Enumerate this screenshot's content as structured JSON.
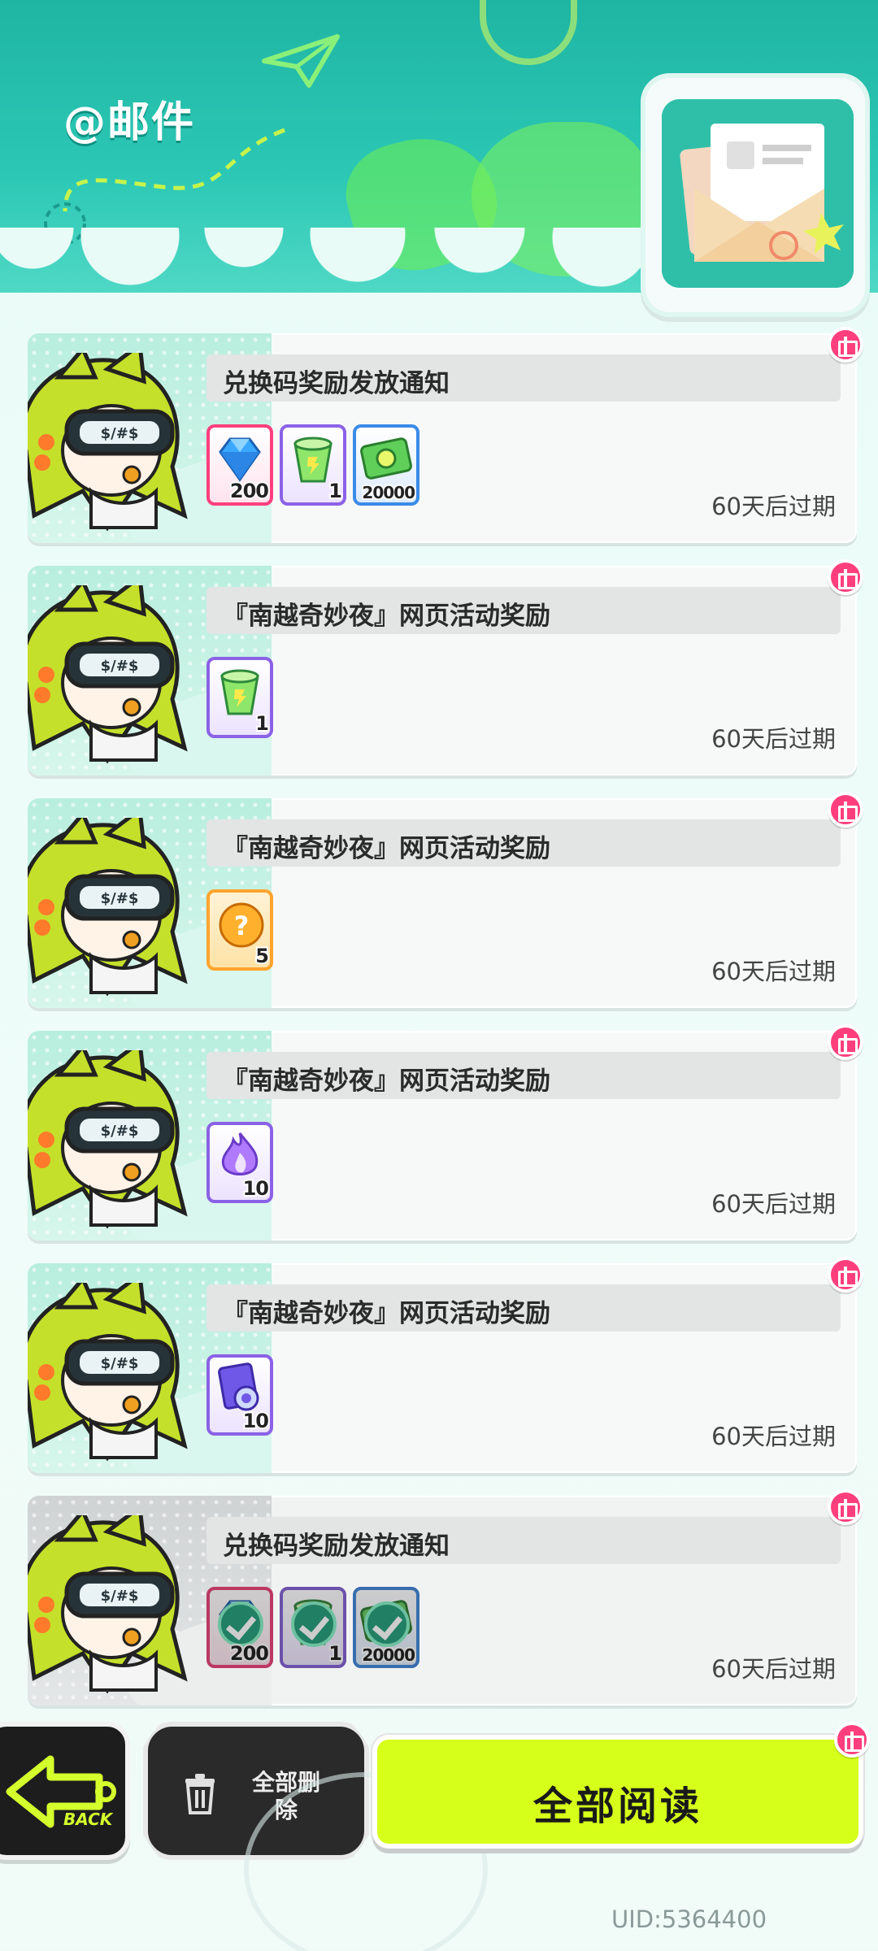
{
  "header": {
    "title": "@邮件"
  },
  "mails": [
    {
      "title": "兑换码奖励发放通知",
      "expire": "60天后过期",
      "read": false,
      "rewards": [
        {
          "icon": "diamond-icon",
          "qty": "200",
          "rarity": "pink"
        },
        {
          "icon": "green-drink-icon",
          "qty": "1",
          "rarity": "purple"
        },
        {
          "icon": "cash-icon",
          "qty": "20000",
          "rarity": "blue"
        }
      ]
    },
    {
      "title": "『南越奇妙夜』网页活动奖励",
      "expire": "60天后过期",
      "read": false,
      "rewards": [
        {
          "icon": "green-drink-icon",
          "qty": "1",
          "rarity": "purple"
        }
      ]
    },
    {
      "title": "『南越奇妙夜』网页活动奖励",
      "expire": "60天后过期",
      "read": false,
      "rewards": [
        {
          "icon": "mystery-orb-icon",
          "qty": "5",
          "rarity": "orange"
        }
      ]
    },
    {
      "title": "『南越奇妙夜』网页活动奖励",
      "expire": "60天后过期",
      "read": false,
      "rewards": [
        {
          "icon": "purple-flame-icon",
          "qty": "10",
          "rarity": "purple"
        }
      ]
    },
    {
      "title": "『南越奇妙夜』网页活动奖励",
      "expire": "60天后过期",
      "read": false,
      "rewards": [
        {
          "icon": "ticket-card-icon",
          "qty": "10",
          "rarity": "purple"
        }
      ]
    },
    {
      "title": "兑换码奖励发放通知",
      "expire": "60天后过期",
      "read": true,
      "rewards": [
        {
          "icon": "diamond-icon",
          "qty": "200",
          "rarity": "pink"
        },
        {
          "icon": "green-drink-icon",
          "qty": "1",
          "rarity": "purple"
        },
        {
          "icon": "cash-icon",
          "qty": "20000",
          "rarity": "blue"
        }
      ]
    }
  ],
  "bottom": {
    "back_label": "BACK",
    "delete_label": "全部删除",
    "read_all_label": "全部阅读",
    "uid": "UID:5364400"
  },
  "colors": {
    "header_teal": "#1fb5a3",
    "accent_lime": "#d6ff1a",
    "gift_pink": "#ff3f7d",
    "claimed_green": "#1aa37a"
  }
}
